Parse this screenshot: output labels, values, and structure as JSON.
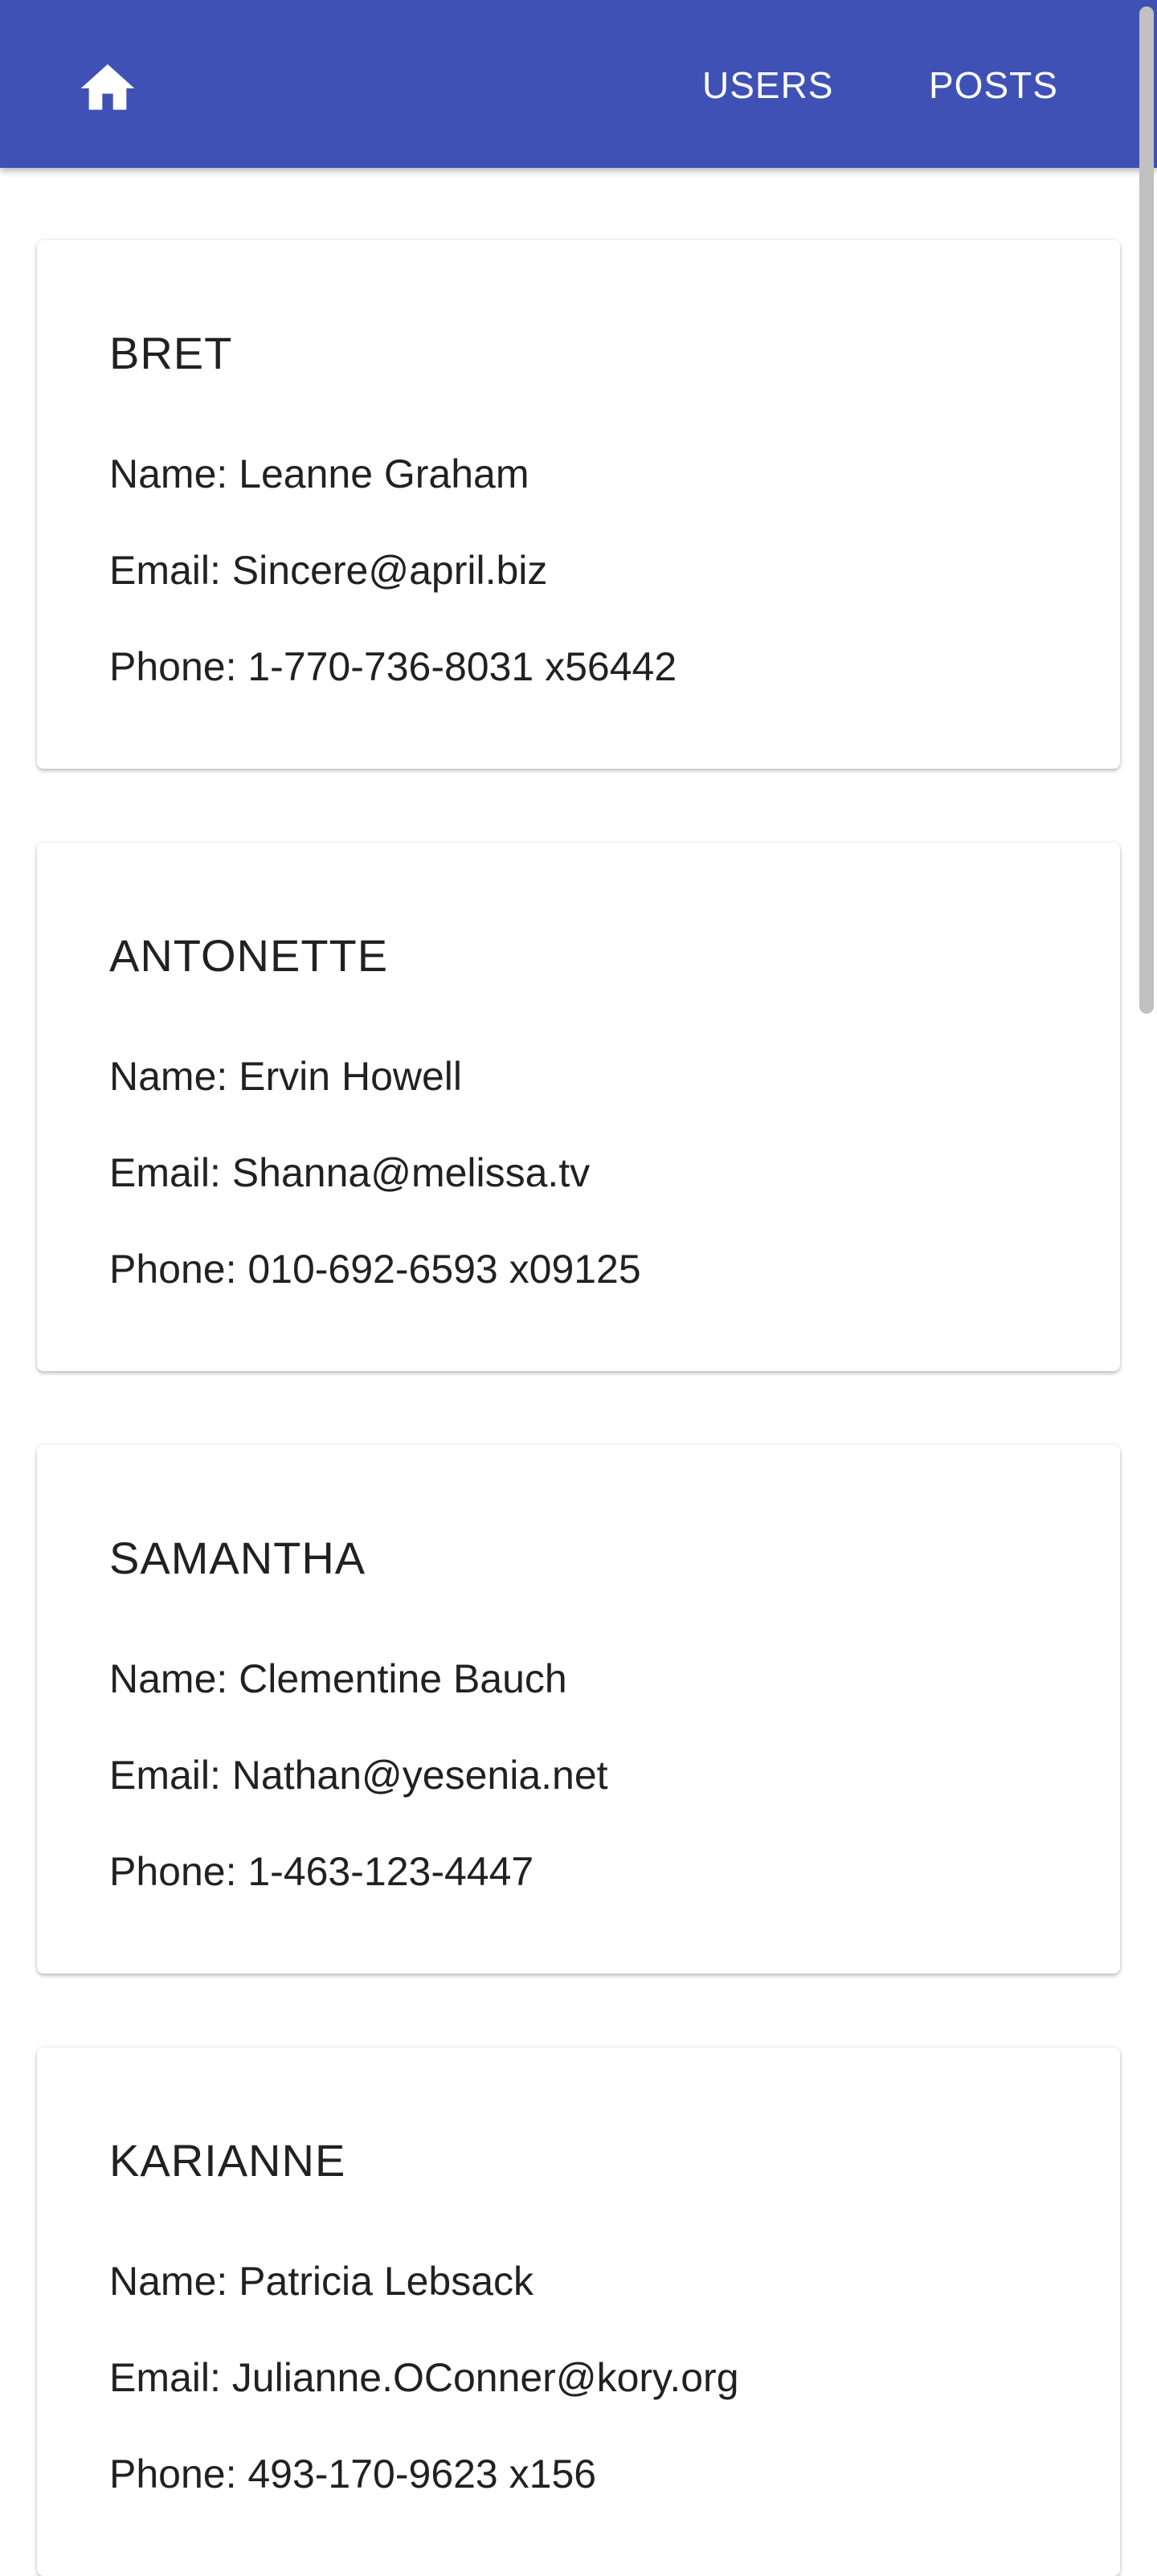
{
  "appbar": {
    "home_icon": "home-icon",
    "color": "#3f51b5",
    "nav": [
      {
        "label": "USERS"
      },
      {
        "label": "POSTS"
      }
    ]
  },
  "users": [
    {
      "username": "BRET",
      "name": "Name: Leanne Graham",
      "email": "Email: Sincere@april.biz",
      "phone": "Phone: 1-770-736-8031 x56442"
    },
    {
      "username": "ANTONETTE",
      "name": "Name: Ervin Howell",
      "email": "Email: Shanna@melissa.tv",
      "phone": "Phone: 010-692-6593 x09125"
    },
    {
      "username": "SAMANTHA",
      "name": "Name: Clementine Bauch",
      "email": "Email: Nathan@yesenia.net",
      "phone": "Phone: 1-463-123-4447"
    },
    {
      "username": "KARIANNE",
      "name": "Name: Patricia Lebsack",
      "email": "Email: Julianne.OConner@kory.org",
      "phone": "Phone: 493-170-9623 x156"
    }
  ]
}
